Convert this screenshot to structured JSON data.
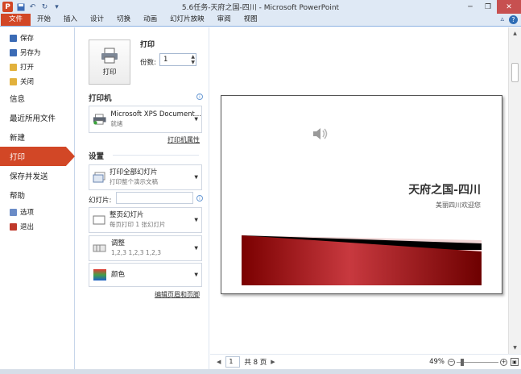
{
  "window": {
    "title": "5.6任务-天府之国-四川  -  Microsoft PowerPoint",
    "app_icon": "P",
    "quick_access": [
      "save-icon",
      "undo-icon",
      "redo-icon",
      "customize-icon"
    ]
  },
  "ribbon": {
    "tabs": [
      "文件",
      "开始",
      "插入",
      "设计",
      "切换",
      "动画",
      "幻灯片放映",
      "审阅",
      "视图"
    ]
  },
  "left_menu": {
    "small_top": [
      {
        "label": "保存",
        "icon": "save-icon",
        "color": "#3b6bb5"
      },
      {
        "label": "另存为",
        "icon": "save-as-icon",
        "color": "#3b6bb5"
      },
      {
        "label": "打开",
        "icon": "open-folder-icon",
        "color": "#e2b13c"
      },
      {
        "label": "关闭",
        "icon": "close-folder-icon",
        "color": "#e2b13c"
      }
    ],
    "big": [
      "信息",
      "最近所用文件",
      "新建",
      "打印",
      "保存并发送",
      "帮助"
    ],
    "selected": "打印",
    "small_bottom": [
      {
        "label": "选项",
        "icon": "options-icon",
        "color": "#6b8cc7"
      },
      {
        "label": "退出",
        "icon": "exit-icon",
        "color": "#c0392b"
      }
    ]
  },
  "print": {
    "button_label": "打印",
    "section_title": "打印",
    "copies_label": "份数:",
    "copies_value": "1",
    "printer_title": "打印机",
    "printer_name": "Microsoft XPS Document...",
    "printer_status": "就绪",
    "printer_props": "打印机属性",
    "settings_title": "设置",
    "range_title": "打印全部幻灯片",
    "range_sub": "打印整个演示文稿",
    "slides_label": "幻灯片:",
    "slides_value": "",
    "layout_title": "整页幻灯片",
    "layout_sub": "每页打印 1 张幻灯片",
    "collate_title": "调整",
    "collate_sub": "1,2,3    1,2,3    1,2,3",
    "color_title": "颜色",
    "header_footer": "编辑页眉和页脚"
  },
  "slide": {
    "title": "天府之国-四川",
    "subtitle": "美丽四川欢迎您"
  },
  "status": {
    "page_value": "1",
    "page_total": "共 8 页",
    "zoom": "49%"
  },
  "colors": {
    "file_tab": "#d24726",
    "ribbon_bg": "#dfe9f5",
    "slide_red": "#8b0000"
  }
}
